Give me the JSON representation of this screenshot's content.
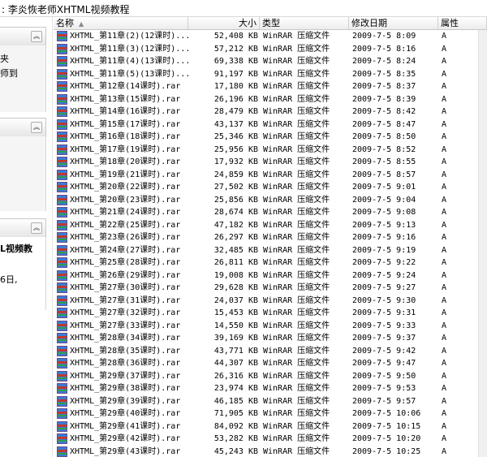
{
  "window": {
    "title": ": 李炎恢老师XHTML视频教程"
  },
  "left_pane": {
    "fragments": [
      "夹",
      "师到",
      "L视频教",
      "6日,"
    ]
  },
  "columns": {
    "name": "名称",
    "size": "大小",
    "type": "类型",
    "date": "修改日期",
    "attr": "属性"
  },
  "files": [
    {
      "name": "XHTML_第11章(2)(12课时)...",
      "size": "52,408 KB",
      "type": "WinRAR 压缩文件",
      "date": "2009-7-5 8:09",
      "attr": "A"
    },
    {
      "name": "XHTML_第11章(3)(12课时)...",
      "size": "57,212 KB",
      "type": "WinRAR 压缩文件",
      "date": "2009-7-5 8:16",
      "attr": "A"
    },
    {
      "name": "XHTML_第11章(4)(13课时)...",
      "size": "69,338 KB",
      "type": "WinRAR 压缩文件",
      "date": "2009-7-5 8:24",
      "attr": "A"
    },
    {
      "name": "XHTML_第11章(5)(13课时)...",
      "size": "91,197 KB",
      "type": "WinRAR 压缩文件",
      "date": "2009-7-5 8:35",
      "attr": "A"
    },
    {
      "name": "XHTML_第12章(14课时).rar",
      "size": "17,180 KB",
      "type": "WinRAR 压缩文件",
      "date": "2009-7-5 8:37",
      "attr": "A"
    },
    {
      "name": "XHTML_第13章(15课时).rar",
      "size": "26,196 KB",
      "type": "WinRAR 压缩文件",
      "date": "2009-7-5 8:39",
      "attr": "A"
    },
    {
      "name": "XHTML_第14章(16课时).rar",
      "size": "28,479 KB",
      "type": "WinRAR 压缩文件",
      "date": "2009-7-5 8:42",
      "attr": "A"
    },
    {
      "name": "XHTML_第15章(17课时).rar",
      "size": "43,137 KB",
      "type": "WinRAR 压缩文件",
      "date": "2009-7-5 8:47",
      "attr": "A"
    },
    {
      "name": "XHTML_第16章(18课时).rar",
      "size": "25,346 KB",
      "type": "WinRAR 压缩文件",
      "date": "2009-7-5 8:50",
      "attr": "A"
    },
    {
      "name": "XHTML_第17章(19课时).rar",
      "size": "25,956 KB",
      "type": "WinRAR 压缩文件",
      "date": "2009-7-5 8:52",
      "attr": "A"
    },
    {
      "name": "XHTML_第18章(20课时).rar",
      "size": "17,932 KB",
      "type": "WinRAR 压缩文件",
      "date": "2009-7-5 8:55",
      "attr": "A"
    },
    {
      "name": "XHTML_第19章(21课时).rar",
      "size": "24,859 KB",
      "type": "WinRAR 压缩文件",
      "date": "2009-7-5 8:57",
      "attr": "A"
    },
    {
      "name": "XHTML_第20章(22课时).rar",
      "size": "27,502 KB",
      "type": "WinRAR 压缩文件",
      "date": "2009-7-5 9:01",
      "attr": "A"
    },
    {
      "name": "XHTML_第20章(23课时).rar",
      "size": "25,856 KB",
      "type": "WinRAR 压缩文件",
      "date": "2009-7-5 9:04",
      "attr": "A"
    },
    {
      "name": "XHTML_第21章(24课时).rar",
      "size": "28,674 KB",
      "type": "WinRAR 压缩文件",
      "date": "2009-7-5 9:08",
      "attr": "A"
    },
    {
      "name": "XHTML_第22章(25课时).rar",
      "size": "47,182 KB",
      "type": "WinRAR 压缩文件",
      "date": "2009-7-5 9:13",
      "attr": "A"
    },
    {
      "name": "XHTML_第23章(26课时).rar",
      "size": "26,297 KB",
      "type": "WinRAR 压缩文件",
      "date": "2009-7-5 9:16",
      "attr": "A"
    },
    {
      "name": "XHTML_第24章(27课时).rar",
      "size": "32,485 KB",
      "type": "WinRAR 压缩文件",
      "date": "2009-7-5 9:19",
      "attr": "A"
    },
    {
      "name": "XHTML_第25章(28课时).rar",
      "size": "26,811 KB",
      "type": "WinRAR 压缩文件",
      "date": "2009-7-5 9:22",
      "attr": "A"
    },
    {
      "name": "XHTML_第26章(29课时).rar",
      "size": "19,008 KB",
      "type": "WinRAR 压缩文件",
      "date": "2009-7-5 9:24",
      "attr": "A"
    },
    {
      "name": "XHTML_第27章(30课时).rar",
      "size": "29,628 KB",
      "type": "WinRAR 压缩文件",
      "date": "2009-7-5 9:27",
      "attr": "A"
    },
    {
      "name": "XHTML_第27章(31课时).rar",
      "size": "24,037 KB",
      "type": "WinRAR 压缩文件",
      "date": "2009-7-5 9:30",
      "attr": "A"
    },
    {
      "name": "XHTML_第27章(32课时).rar",
      "size": "15,453 KB",
      "type": "WinRAR 压缩文件",
      "date": "2009-7-5 9:31",
      "attr": "A"
    },
    {
      "name": "XHTML_第27章(33课时).rar",
      "size": "14,550 KB",
      "type": "WinRAR 压缩文件",
      "date": "2009-7-5 9:33",
      "attr": "A"
    },
    {
      "name": "XHTML_第28章(34课时).rar",
      "size": "39,169 KB",
      "type": "WinRAR 压缩文件",
      "date": "2009-7-5 9:37",
      "attr": "A"
    },
    {
      "name": "XHTML_第28章(35课时).rar",
      "size": "43,771 KB",
      "type": "WinRAR 压缩文件",
      "date": "2009-7-5 9:42",
      "attr": "A"
    },
    {
      "name": "XHTML_第28章(36课时).rar",
      "size": "44,307 KB",
      "type": "WinRAR 压缩文件",
      "date": "2009-7-5 9:47",
      "attr": "A"
    },
    {
      "name": "XHTML_第29章(37课时).rar",
      "size": "26,316 KB",
      "type": "WinRAR 压缩文件",
      "date": "2009-7-5 9:50",
      "attr": "A"
    },
    {
      "name": "XHTML_第29章(38课时).rar",
      "size": "23,974 KB",
      "type": "WinRAR 压缩文件",
      "date": "2009-7-5 9:53",
      "attr": "A"
    },
    {
      "name": "XHTML_第29章(39课时).rar",
      "size": "46,185 KB",
      "type": "WinRAR 压缩文件",
      "date": "2009-7-5 9:57",
      "attr": "A"
    },
    {
      "name": "XHTML_第29章(40课时).rar",
      "size": "71,905 KB",
      "type": "WinRAR 压缩文件",
      "date": "2009-7-5 10:06",
      "attr": "A"
    },
    {
      "name": "XHTML_第29章(41课时).rar",
      "size": "84,092 KB",
      "type": "WinRAR 压缩文件",
      "date": "2009-7-5 10:15",
      "attr": "A"
    },
    {
      "name": "XHTML_第29章(42课时).rar",
      "size": "53,282 KB",
      "type": "WinRAR 压缩文件",
      "date": "2009-7-5 10:20",
      "attr": "A"
    },
    {
      "name": "XHTML_第29章(43课时).rar",
      "size": "45,243 KB",
      "type": "WinRAR 压缩文件",
      "date": "2009-7-5 10:25",
      "attr": "A"
    }
  ]
}
